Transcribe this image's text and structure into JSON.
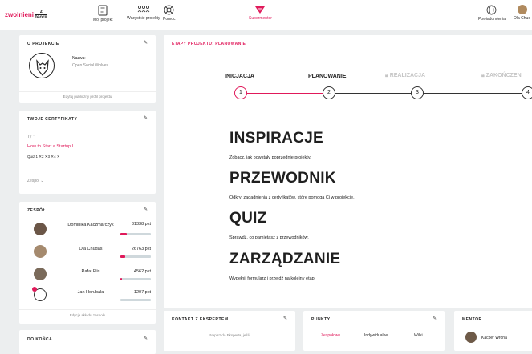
{
  "brand": {
    "logo_text": "zwolnieni",
    "logo_z": "z",
    "logo_bottom": "teorii"
  },
  "nav": {
    "my_project": "Mój projekt",
    "all_projects": "Wszystkie projekty",
    "help": "Pomoc",
    "supermentor": "Supermentor",
    "notifications": "Powiadomienia",
    "user": "Ola Chud"
  },
  "about": {
    "title": "O PROJEKCIE",
    "name_label": "Nazwa:",
    "project_name": "Open Social Wolves",
    "edit_link": "Edytuj publiczny profil projektu"
  },
  "certs": {
    "title": "TWOJE CERTYFIKATY",
    "you_label": "Ty",
    "course": "How to Start a Startup I",
    "quiz": "Quiz 1  ✕2  ✕3  ✕4  ✕",
    "team_label": "Zespół"
  },
  "team": {
    "title": "ZESPÓŁ",
    "members": [
      {
        "name": "Dominika Kaczmarczyk",
        "points": "31338 pkt",
        "progress": 0.22
      },
      {
        "name": "Ola Chudaś",
        "points": "26763 pkt",
        "progress": 0.15
      },
      {
        "name": "Rafał Flis",
        "points": "4562 pkt",
        "progress": 0.05
      },
      {
        "name": "Jan Horubała",
        "points": "1207 pkt",
        "progress": 0.0
      }
    ],
    "edit_link": "Edycja składu zespołu"
  },
  "deadline": {
    "title": "DO KOŃCA"
  },
  "stages": {
    "header_prefix": "ETAPY PROJEKTU:",
    "header_current": "PLANOWANIE",
    "steps": [
      {
        "label": "INICJACJA",
        "num": "1"
      },
      {
        "label": "PLANOWANIE",
        "num": "2"
      },
      {
        "label": "REALIZACJA",
        "num": "3"
      },
      {
        "label": "ZAKOŃCZEN",
        "num": "4"
      }
    ]
  },
  "sections": [
    {
      "title": "INSPIRACJE",
      "desc": "Zobacz, jak powstały poprzednie projekty."
    },
    {
      "title": "PRZEWODNIK",
      "desc": "Odkryj zagadnienia z certyfikatów, które pomogą Ci w projekcie."
    },
    {
      "title": "QUIZ",
      "desc": "Sprawdź, co pamiętasz z przewodników."
    },
    {
      "title": "ZARZĄDZANIE",
      "desc": "Wypełnij formularz i przejdź na kolejny etap."
    }
  ],
  "expert": {
    "title": "KONTAKT Z EKSPERTEM",
    "text": "Napisz do Eksperta, jeśli"
  },
  "points": {
    "title": "PUNKTY",
    "tabs": [
      "Zespołowe",
      "Indywidualne",
      "Wilki"
    ]
  },
  "mentor": {
    "title": "MENTOR",
    "name": "Kacper Wrona"
  },
  "colors": {
    "accent": "#e0195a",
    "background": "#eceeef"
  }
}
